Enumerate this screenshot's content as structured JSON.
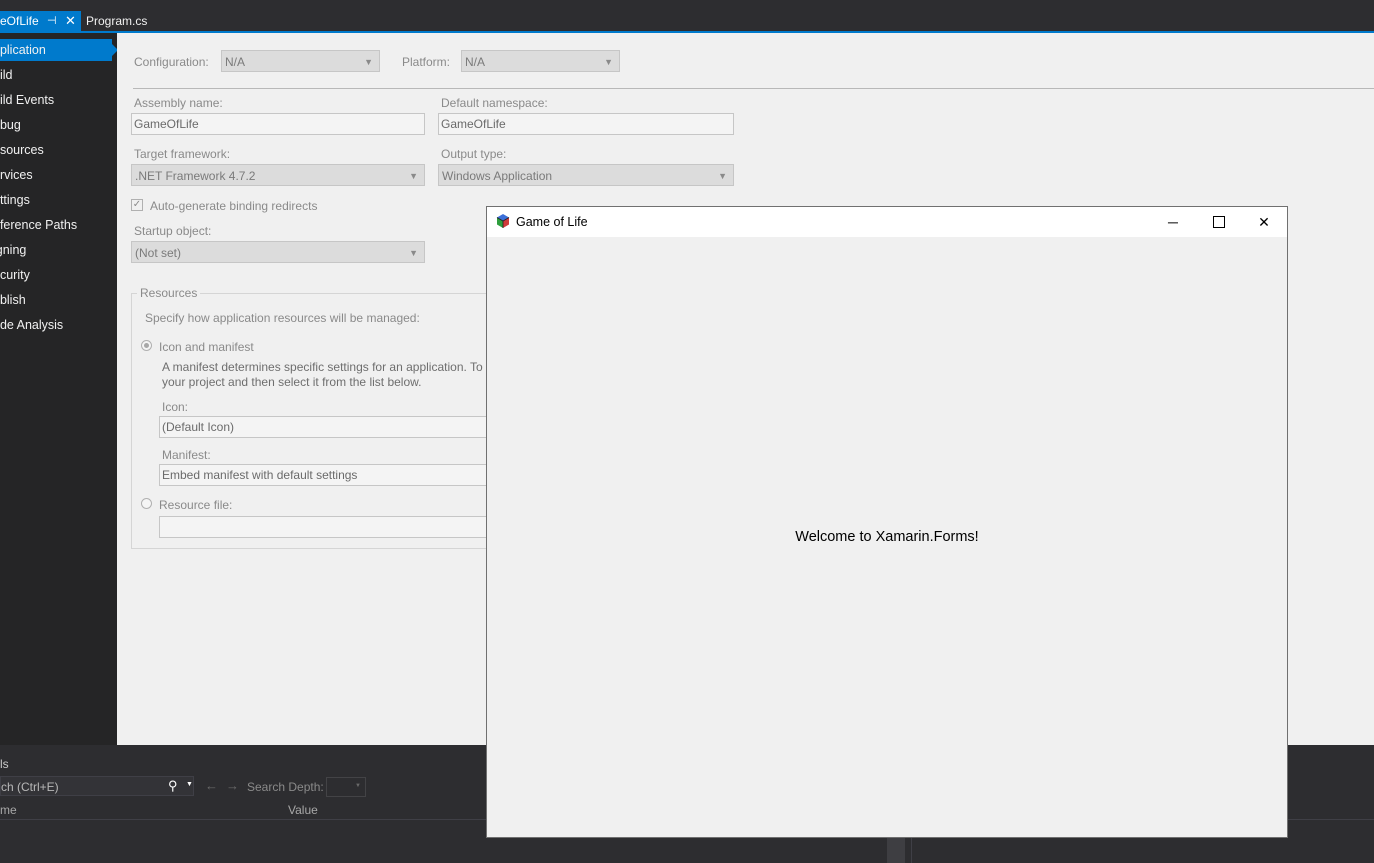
{
  "tabs": {
    "active_label": "eOfLife",
    "second_label": "Program.cs"
  },
  "sidebar": {
    "items": [
      {
        "label": "pplication"
      },
      {
        "label": "uild"
      },
      {
        "label": "uild Events"
      },
      {
        "label": "ebug"
      },
      {
        "label": "esources"
      },
      {
        "label": "ervices"
      },
      {
        "label": "ettings"
      },
      {
        "label": "eference Paths"
      },
      {
        "label": "igning"
      },
      {
        "label": "ecurity"
      },
      {
        "label": "ublish"
      },
      {
        "label": "ode Analysis"
      }
    ]
  },
  "page": {
    "configuration_label": "Configuration:",
    "configuration_value": "N/A",
    "platform_label": "Platform:",
    "platform_value": "N/A",
    "assembly_label": "Assembly name:",
    "assembly_value": "GameOfLife",
    "namespace_label": "Default namespace:",
    "namespace_value": "GameOfLife",
    "framework_label": "Target framework:",
    "framework_value": ".NET Framework 4.7.2",
    "output_label": "Output type:",
    "output_value": "Windows Application",
    "binding_label": "Auto-generate binding redirects",
    "startup_label": "Startup object:",
    "startup_value": "(Not set)",
    "resources": {
      "title": "Resources",
      "desc": "Specify how application resources will be managed:",
      "icon_manifest_label": "Icon and manifest",
      "manifest_text_1": "A manifest determines specific settings for an application. To a",
      "manifest_text_2": "your project and then select it from the list below.",
      "icon_label": "Icon:",
      "icon_value": "(Default Icon)",
      "manifest_label": "Manifest:",
      "manifest_value": "Embed manifest with default settings",
      "resource_file_label": "Resource file:"
    }
  },
  "bottom_panel": {
    "title": "ls",
    "search_placeholder": "ch (Ctrl+E)",
    "search_depth_label": "Search Depth:",
    "col_name": "me",
    "col_value": "Value"
  },
  "window": {
    "title": "Game of Life",
    "welcome_text": "Welcome to Xamarin.Forms!"
  }
}
